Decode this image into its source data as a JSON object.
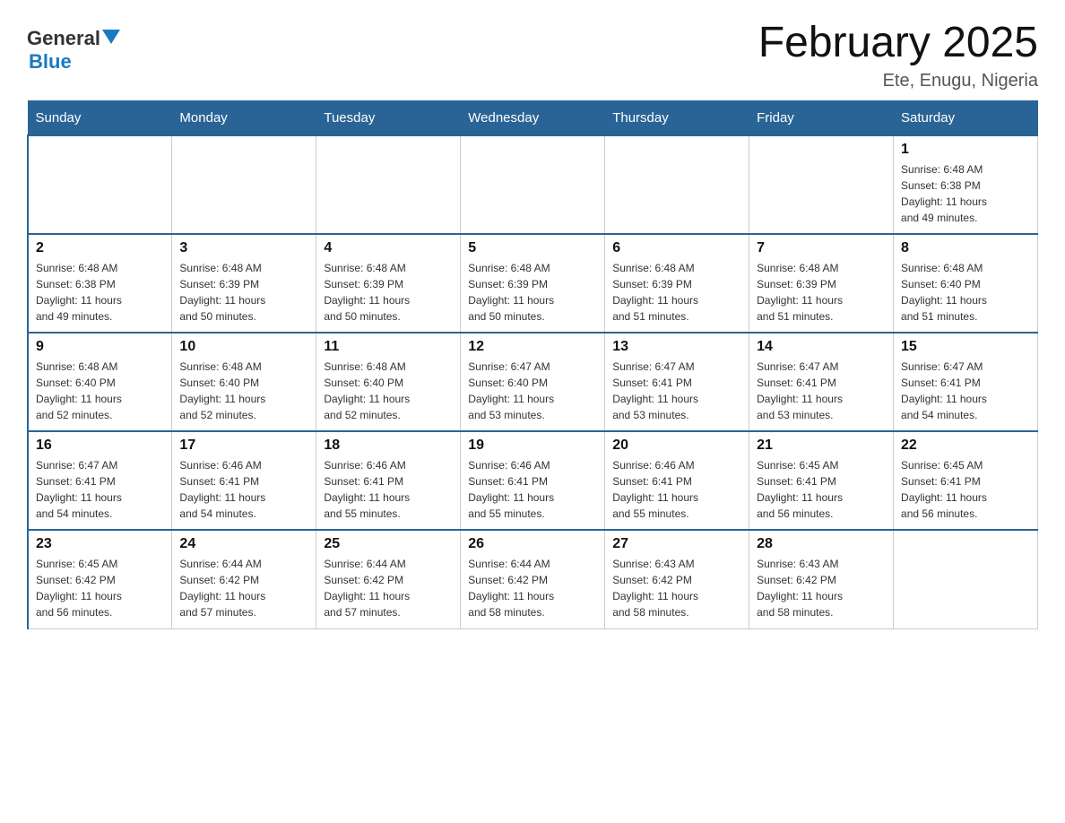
{
  "header": {
    "title": "February 2025",
    "subtitle": "Ete, Enugu, Nigeria"
  },
  "logo": {
    "line1": "General",
    "line2": "Blue"
  },
  "weekdays": [
    "Sunday",
    "Monday",
    "Tuesday",
    "Wednesday",
    "Thursday",
    "Friday",
    "Saturday"
  ],
  "weeks": [
    [
      {
        "day": "",
        "info": ""
      },
      {
        "day": "",
        "info": ""
      },
      {
        "day": "",
        "info": ""
      },
      {
        "day": "",
        "info": ""
      },
      {
        "day": "",
        "info": ""
      },
      {
        "day": "",
        "info": ""
      },
      {
        "day": "1",
        "info": "Sunrise: 6:48 AM\nSunset: 6:38 PM\nDaylight: 11 hours\nand 49 minutes."
      }
    ],
    [
      {
        "day": "2",
        "info": "Sunrise: 6:48 AM\nSunset: 6:38 PM\nDaylight: 11 hours\nand 49 minutes."
      },
      {
        "day": "3",
        "info": "Sunrise: 6:48 AM\nSunset: 6:39 PM\nDaylight: 11 hours\nand 50 minutes."
      },
      {
        "day": "4",
        "info": "Sunrise: 6:48 AM\nSunset: 6:39 PM\nDaylight: 11 hours\nand 50 minutes."
      },
      {
        "day": "5",
        "info": "Sunrise: 6:48 AM\nSunset: 6:39 PM\nDaylight: 11 hours\nand 50 minutes."
      },
      {
        "day": "6",
        "info": "Sunrise: 6:48 AM\nSunset: 6:39 PM\nDaylight: 11 hours\nand 51 minutes."
      },
      {
        "day": "7",
        "info": "Sunrise: 6:48 AM\nSunset: 6:39 PM\nDaylight: 11 hours\nand 51 minutes."
      },
      {
        "day": "8",
        "info": "Sunrise: 6:48 AM\nSunset: 6:40 PM\nDaylight: 11 hours\nand 51 minutes."
      }
    ],
    [
      {
        "day": "9",
        "info": "Sunrise: 6:48 AM\nSunset: 6:40 PM\nDaylight: 11 hours\nand 52 minutes."
      },
      {
        "day": "10",
        "info": "Sunrise: 6:48 AM\nSunset: 6:40 PM\nDaylight: 11 hours\nand 52 minutes."
      },
      {
        "day": "11",
        "info": "Sunrise: 6:48 AM\nSunset: 6:40 PM\nDaylight: 11 hours\nand 52 minutes."
      },
      {
        "day": "12",
        "info": "Sunrise: 6:47 AM\nSunset: 6:40 PM\nDaylight: 11 hours\nand 53 minutes."
      },
      {
        "day": "13",
        "info": "Sunrise: 6:47 AM\nSunset: 6:41 PM\nDaylight: 11 hours\nand 53 minutes."
      },
      {
        "day": "14",
        "info": "Sunrise: 6:47 AM\nSunset: 6:41 PM\nDaylight: 11 hours\nand 53 minutes."
      },
      {
        "day": "15",
        "info": "Sunrise: 6:47 AM\nSunset: 6:41 PM\nDaylight: 11 hours\nand 54 minutes."
      }
    ],
    [
      {
        "day": "16",
        "info": "Sunrise: 6:47 AM\nSunset: 6:41 PM\nDaylight: 11 hours\nand 54 minutes."
      },
      {
        "day": "17",
        "info": "Sunrise: 6:46 AM\nSunset: 6:41 PM\nDaylight: 11 hours\nand 54 minutes."
      },
      {
        "day": "18",
        "info": "Sunrise: 6:46 AM\nSunset: 6:41 PM\nDaylight: 11 hours\nand 55 minutes."
      },
      {
        "day": "19",
        "info": "Sunrise: 6:46 AM\nSunset: 6:41 PM\nDaylight: 11 hours\nand 55 minutes."
      },
      {
        "day": "20",
        "info": "Sunrise: 6:46 AM\nSunset: 6:41 PM\nDaylight: 11 hours\nand 55 minutes."
      },
      {
        "day": "21",
        "info": "Sunrise: 6:45 AM\nSunset: 6:41 PM\nDaylight: 11 hours\nand 56 minutes."
      },
      {
        "day": "22",
        "info": "Sunrise: 6:45 AM\nSunset: 6:41 PM\nDaylight: 11 hours\nand 56 minutes."
      }
    ],
    [
      {
        "day": "23",
        "info": "Sunrise: 6:45 AM\nSunset: 6:42 PM\nDaylight: 11 hours\nand 56 minutes."
      },
      {
        "day": "24",
        "info": "Sunrise: 6:44 AM\nSunset: 6:42 PM\nDaylight: 11 hours\nand 57 minutes."
      },
      {
        "day": "25",
        "info": "Sunrise: 6:44 AM\nSunset: 6:42 PM\nDaylight: 11 hours\nand 57 minutes."
      },
      {
        "day": "26",
        "info": "Sunrise: 6:44 AM\nSunset: 6:42 PM\nDaylight: 11 hours\nand 58 minutes."
      },
      {
        "day": "27",
        "info": "Sunrise: 6:43 AM\nSunset: 6:42 PM\nDaylight: 11 hours\nand 58 minutes."
      },
      {
        "day": "28",
        "info": "Sunrise: 6:43 AM\nSunset: 6:42 PM\nDaylight: 11 hours\nand 58 minutes."
      },
      {
        "day": "",
        "info": ""
      }
    ]
  ]
}
